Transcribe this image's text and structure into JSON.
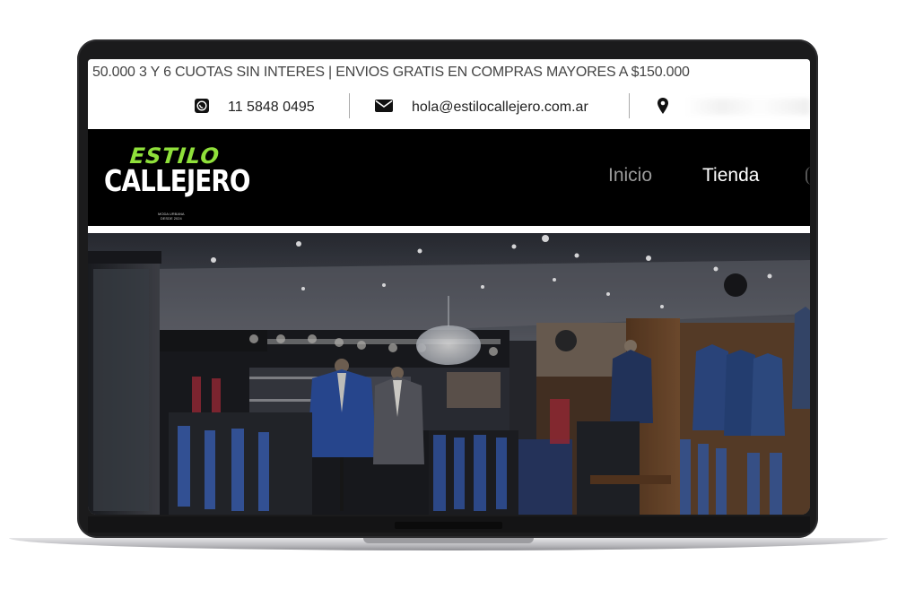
{
  "announcement": "50.000 3 Y 6 CUOTAS SIN INTERES | ENVIOS GRATIS EN COMPRAS MAYORES A $150.000",
  "contact": {
    "phone": "11 5848 0495",
    "email": "hola@estilocallejero.com.ar",
    "icons": [
      "whatsapp-icon",
      "mail-icon",
      "location-pin-icon"
    ]
  },
  "brand": {
    "top_word": "ESTILO",
    "main_word": "CALLEJERO",
    "tagline_1": "MODA URBANA",
    "tagline_2": "DESDE 2024",
    "accent_color": "#8fe03a"
  },
  "nav": {
    "items": [
      {
        "label": "Inicio",
        "color": "#9a9a9a"
      },
      {
        "label": "Tienda",
        "color": "#ffffff"
      }
    ]
  },
  "hero": {
    "image_subject": "clothing-store-interior"
  }
}
